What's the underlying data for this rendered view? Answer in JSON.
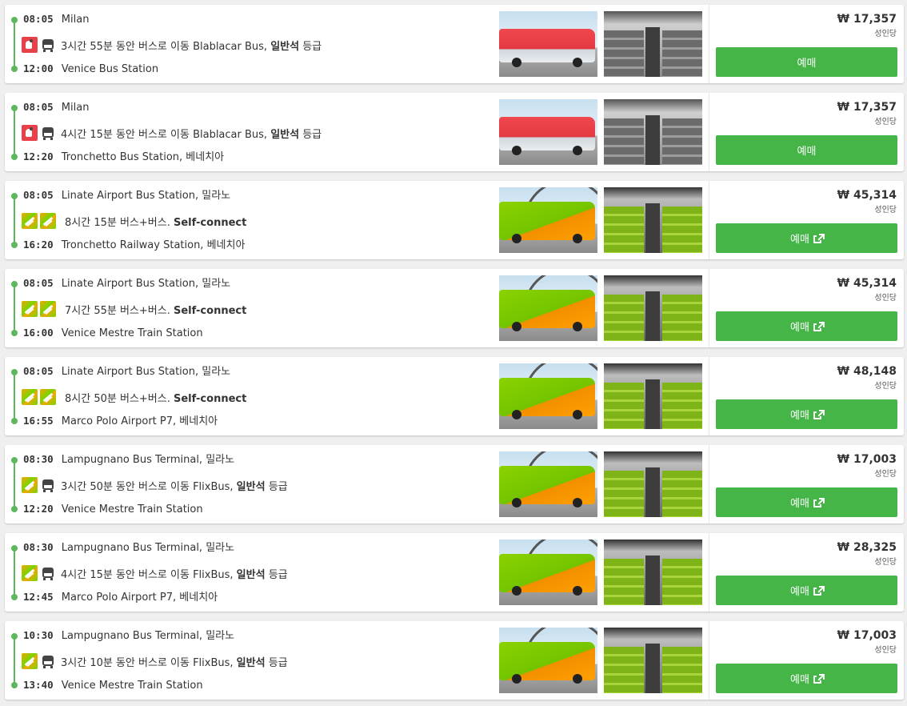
{
  "currency_symbol": "₩",
  "per_person_label": "성인당",
  "book_label": "예매",
  "colors": {
    "accent": "#44b546",
    "timeline": "#5cb85c",
    "blablacar": "#e9414a",
    "flixbus": "#73d700"
  },
  "results": [
    {
      "departure_time": "08:05",
      "departure_station": "Milan",
      "operator_icons": [
        "blablacar-icon"
      ],
      "show_bus_icon": true,
      "duration_text": "3시간 55분 동안 버스로 이동 Blablacar Bus, ",
      "class_bold": "일반석",
      "class_suffix": " 등급",
      "arrival_time": "12:00",
      "arrival_station": "Venice Bus Station",
      "price": "₩ 17,357",
      "external_link": false,
      "photo_style": "blabla"
    },
    {
      "departure_time": "08:05",
      "departure_station": "Milan",
      "operator_icons": [
        "blablacar-icon"
      ],
      "show_bus_icon": true,
      "duration_text": "4시간 15분 동안 버스로 이동 Blablacar Bus, ",
      "class_bold": "일반석",
      "class_suffix": " 등급",
      "arrival_time": "12:20",
      "arrival_station": "Tronchetto Bus Station, 베네치아",
      "price": "₩ 17,357",
      "external_link": false,
      "photo_style": "blabla"
    },
    {
      "departure_time": "08:05",
      "departure_station": "Linate Airport Bus Station, 밀라노",
      "operator_icons": [
        "flixbus-icon",
        "flixbus-icon"
      ],
      "show_bus_icon": false,
      "duration_text": "8시간 15분 버스+버스. ",
      "class_bold": "Self-connect",
      "class_suffix": "",
      "arrival_time": "16:20",
      "arrival_station": "Tronchetto Railway Station, 베네치아",
      "price": "₩ 45,314",
      "external_link": true,
      "photo_style": "flix"
    },
    {
      "departure_time": "08:05",
      "departure_station": "Linate Airport Bus Station, 밀라노",
      "operator_icons": [
        "flixbus-icon",
        "flixbus-icon"
      ],
      "show_bus_icon": false,
      "duration_text": "7시간 55분 버스+버스. ",
      "class_bold": "Self-connect",
      "class_suffix": "",
      "arrival_time": "16:00",
      "arrival_station": "Venice Mestre Train Station",
      "price": "₩ 45,314",
      "external_link": true,
      "photo_style": "flix"
    },
    {
      "departure_time": "08:05",
      "departure_station": "Linate Airport Bus Station, 밀라노",
      "operator_icons": [
        "flixbus-icon",
        "flixbus-icon"
      ],
      "show_bus_icon": false,
      "duration_text": "8시간 50분 버스+버스. ",
      "class_bold": "Self-connect",
      "class_suffix": "",
      "arrival_time": "16:55",
      "arrival_station": "Marco Polo Airport P7, 베네치아",
      "price": "₩ 48,148",
      "external_link": true,
      "photo_style": "flix"
    },
    {
      "departure_time": "08:30",
      "departure_station": "Lampugnano Bus Terminal, 밀라노",
      "operator_icons": [
        "flixbus-icon"
      ],
      "show_bus_icon": true,
      "duration_text": "3시간 50분 동안 버스로 이동 FlixBus, ",
      "class_bold": "일반석",
      "class_suffix": " 등급",
      "arrival_time": "12:20",
      "arrival_station": "Venice Mestre Train Station",
      "price": "₩ 17,003",
      "external_link": true,
      "photo_style": "flix"
    },
    {
      "departure_time": "08:30",
      "departure_station": "Lampugnano Bus Terminal, 밀라노",
      "operator_icons": [
        "flixbus-icon"
      ],
      "show_bus_icon": true,
      "duration_text": "4시간 15분 동안 버스로 이동 FlixBus, ",
      "class_bold": "일반석",
      "class_suffix": " 등급",
      "arrival_time": "12:45",
      "arrival_station": "Marco Polo Airport P7, 베네치아",
      "price": "₩ 28,325",
      "external_link": true,
      "photo_style": "flix"
    },
    {
      "departure_time": "10:30",
      "departure_station": "Lampugnano Bus Terminal, 밀라노",
      "operator_icons": [
        "flixbus-icon"
      ],
      "show_bus_icon": true,
      "duration_text": "3시간 10분 동안 버스로 이동 FlixBus, ",
      "class_bold": "일반석",
      "class_suffix": " 등급",
      "arrival_time": "13:40",
      "arrival_station": "Venice Mestre Train Station",
      "price": "₩ 17,003",
      "external_link": true,
      "photo_style": "flix"
    }
  ]
}
